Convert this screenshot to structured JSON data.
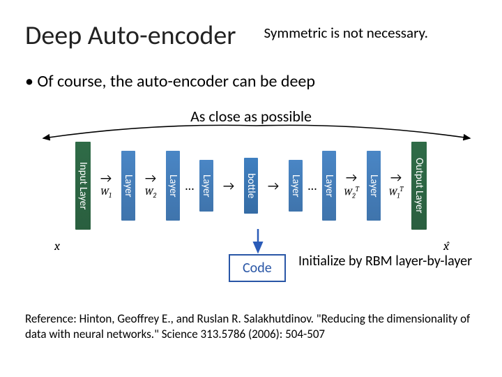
{
  "title": "Deep Auto-encoder",
  "side_note": "Symmetric is not necessary.",
  "bullet": "Of course, the auto-encoder can be deep",
  "close_label": "As close as possible",
  "layers": {
    "input": "Input Layer",
    "output": "Output Layer",
    "layer": "Layer",
    "bottle": "bottle"
  },
  "weights": {
    "w1": "W",
    "w1_sub": "1",
    "w2": "W",
    "w2_sub": "2",
    "w2t": "W",
    "w2t_sub": "2",
    "w2t_sup": "T",
    "w1t": "W",
    "w1t_sub": "1",
    "w1t_sup": "T"
  },
  "dots": "…",
  "x_left": "x",
  "x_right": "x̂",
  "code_label": "Code",
  "rbm_note": "Initialize by RBM layer-by-layer",
  "reference": "Reference: Hinton, Geoffrey E., and Ruslan R. Salakhutdinov. \"Reducing the dimensionality of data with neural networks.\" Science 313.5786 (2006): 504-507"
}
